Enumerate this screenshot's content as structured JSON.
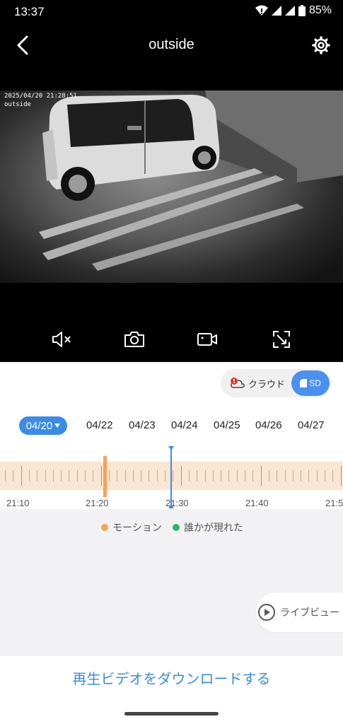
{
  "status_bar": {
    "time": "13:37",
    "battery": "85%",
    "icons": [
      "wifi-icon",
      "signal-icon",
      "signal-icon",
      "battery-icon"
    ]
  },
  "header": {
    "title": "outside",
    "back_icon": "chevron-left-icon",
    "settings_icon": "gear-icon"
  },
  "video": {
    "timestamp": "2025/04/20 21:28:51",
    "camera_label": "outside"
  },
  "controls": {
    "icons": [
      "mute-icon",
      "camera-icon",
      "video-record-icon",
      "fullscreen-icon"
    ]
  },
  "storage_toggle": {
    "cloud_label": "クラウド",
    "sd_label": "SD",
    "selected": "SD"
  },
  "dates": {
    "selected": "04/20",
    "items": [
      "04/22",
      "04/23",
      "04/24",
      "04/25",
      "04/26",
      "04/27"
    ]
  },
  "timeline": {
    "labels": [
      "21:10",
      "21:20",
      "21:30",
      "21:40",
      "21:5"
    ]
  },
  "legend": {
    "motion": "モーション",
    "person": "誰かが現れた",
    "motion_color": "#f5a44e",
    "person_color": "#27b86f"
  },
  "live_button": {
    "label": "ライブビュー"
  },
  "download": {
    "label": "再生ビデオをダウンロードする"
  },
  "colors": {
    "accent": "#3a8ce8"
  }
}
